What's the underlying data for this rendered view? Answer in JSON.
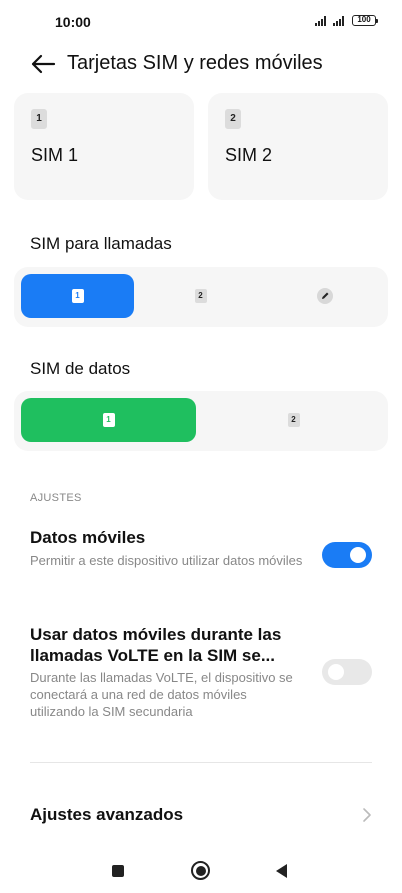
{
  "status_bar": {
    "time": "10:00",
    "battery": "100"
  },
  "header": {
    "title": "Tarjetas SIM y redes móviles"
  },
  "sim_cards": [
    {
      "badge": "1",
      "name": "SIM 1"
    },
    {
      "badge": "2",
      "name": "SIM 2"
    }
  ],
  "calls_section": {
    "title": "SIM para llamadas",
    "options": [
      {
        "badge": "1",
        "selected": true
      },
      {
        "badge": "2",
        "selected": false
      },
      {
        "icon": "pencil-icon",
        "selected": false
      }
    ]
  },
  "data_section": {
    "title": "SIM de datos",
    "options": [
      {
        "badge": "1",
        "selected": true
      },
      {
        "badge": "2",
        "selected": false
      }
    ]
  },
  "settings": {
    "group_label": "AJUSTES",
    "mobile_data": {
      "title": "Datos móviles",
      "description": "Permitir a este dispositivo utilizar datos móviles",
      "enabled": true
    },
    "volte_data": {
      "title": "Usar datos móviles durante las llamadas VoLTE en la SIM se...",
      "description": "Durante las llamadas VoLTE, el dispositivo se conectará a una red de datos móviles utilizando la SIM secundaria",
      "enabled": false
    },
    "advanced": {
      "title": "Ajustes avanzados"
    }
  },
  "colors": {
    "accent_blue": "#1a7cf5",
    "accent_green": "#1fbf5f",
    "card_bg": "#f6f6f6"
  }
}
